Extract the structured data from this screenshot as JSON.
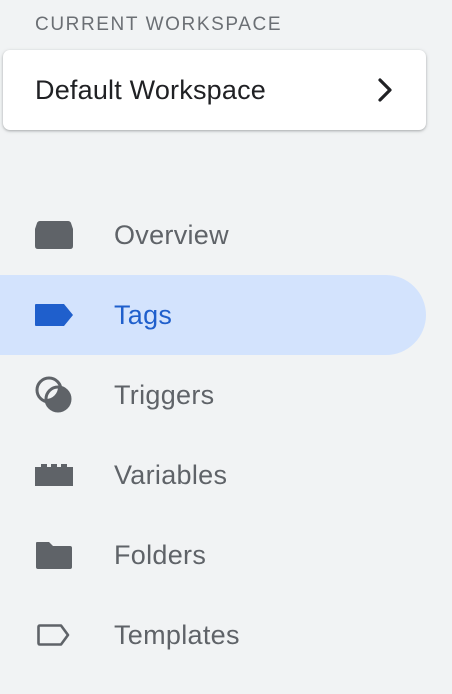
{
  "workspace": {
    "label": "CURRENT WORKSPACE",
    "name": "Default Workspace",
    "chevron_icon": "chevron-right-icon"
  },
  "nav": {
    "items": [
      {
        "label": "Overview",
        "icon": "overview-icon",
        "active": false
      },
      {
        "label": "Tags",
        "icon": "tag-icon",
        "active": true
      },
      {
        "label": "Triggers",
        "icon": "trigger-icon",
        "active": false
      },
      {
        "label": "Variables",
        "icon": "variables-icon",
        "active": false
      },
      {
        "label": "Folders",
        "icon": "folder-icon",
        "active": false
      },
      {
        "label": "Templates",
        "icon": "template-icon",
        "active": false
      }
    ]
  },
  "colors": {
    "background": "#f1f3f4",
    "active_background": "#d3e3fd",
    "active_text": "#1f5fcc",
    "icon_gray": "#5f6368",
    "text_gray": "#5f6368"
  }
}
